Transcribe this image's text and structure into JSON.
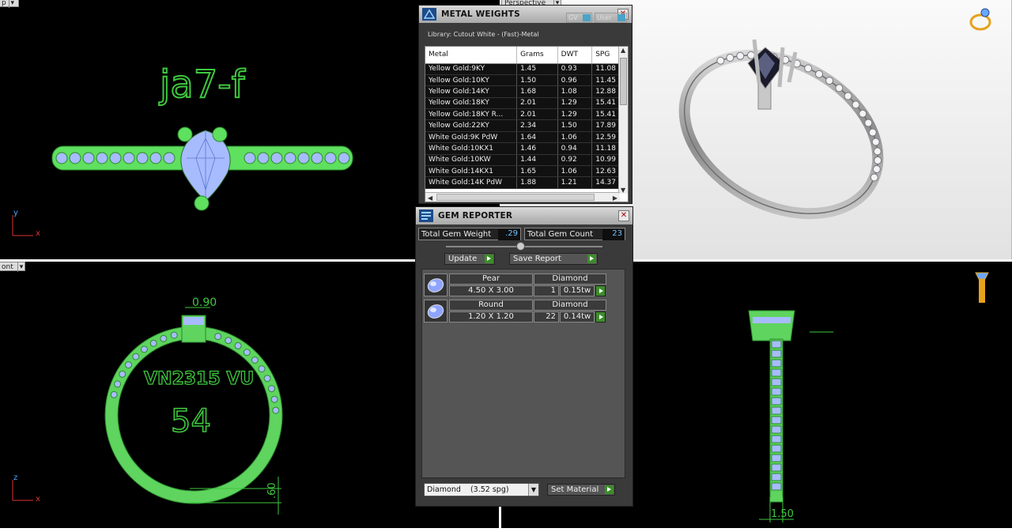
{
  "viewports": {
    "top": {
      "label": "p",
      "sketch_text": "ja7-f",
      "axis_y": "y",
      "axis_x": "x"
    },
    "perspective": {
      "label": "Perspective"
    },
    "front": {
      "label": "ont",
      "text_line1": "VN2315 VU",
      "text_line2": "54",
      "dim_top": "0.90",
      "dim_side": ".60",
      "axis_y": "z",
      "axis_x": "x"
    },
    "side": {
      "dim_bottom": "1.50"
    }
  },
  "metal_weights": {
    "title": "METAL WEIGHTS",
    "library": "Library: Cutout White - (Fast)-Metal",
    "toggle_gv": "GV",
    "toggle_user": "User",
    "columns": [
      "Metal",
      "Grams",
      "DWT",
      "SPG"
    ],
    "rows": [
      [
        "Yellow Gold:9KY",
        "1.45",
        "0.93",
        "11.08"
      ],
      [
        "Yellow Gold:10KY",
        "1.50",
        "0.96",
        "11.45"
      ],
      [
        "Yellow Gold:14KY",
        "1.68",
        "1.08",
        "12.88"
      ],
      [
        "Yellow Gold:18KY",
        "2.01",
        "1.29",
        "15.41"
      ],
      [
        "Yellow Gold:18KY R...",
        "2.01",
        "1.29",
        "15.41"
      ],
      [
        "Yellow Gold:22KY",
        "2.34",
        "1.50",
        "17.89"
      ],
      [
        "White Gold:9K PdW",
        "1.64",
        "1.06",
        "12.59"
      ],
      [
        "White Gold:10KX1",
        "1.46",
        "0.94",
        "11.18"
      ],
      [
        "White Gold:10KW",
        "1.44",
        "0.92",
        "10.99"
      ],
      [
        "White Gold:14KX1",
        "1.65",
        "1.06",
        "12.63"
      ],
      [
        "White Gold:14K PdW",
        "1.88",
        "1.21",
        "14.37"
      ]
    ]
  },
  "gem_reporter": {
    "title": "GEM REPORTER",
    "total_weight_label": "Total Gem Weight",
    "total_weight_value": ".29",
    "total_count_label": "Total Gem Count",
    "total_count_value": "23",
    "update_label": "Update",
    "save_report_label": "Save Report",
    "gems": [
      {
        "shape": "Pear",
        "size": "4.50 X 3.00",
        "material": "Diamond",
        "count": "1",
        "weight": "0.15tw"
      },
      {
        "shape": "Round",
        "size": "1.20 X 1.20",
        "material": "Diamond",
        "count": "22",
        "weight": "0.14tw"
      }
    ],
    "material_select": "Diamond    (3.52 spg)",
    "set_material_label": "Set Material"
  },
  "colors": {
    "sketch_green": "#3ec83e",
    "gem_blue": "#9fb6ff",
    "panel_bg": "#3a3a3a",
    "value_blue": "#6fc3ff",
    "go_green": "#3c8d2a"
  }
}
